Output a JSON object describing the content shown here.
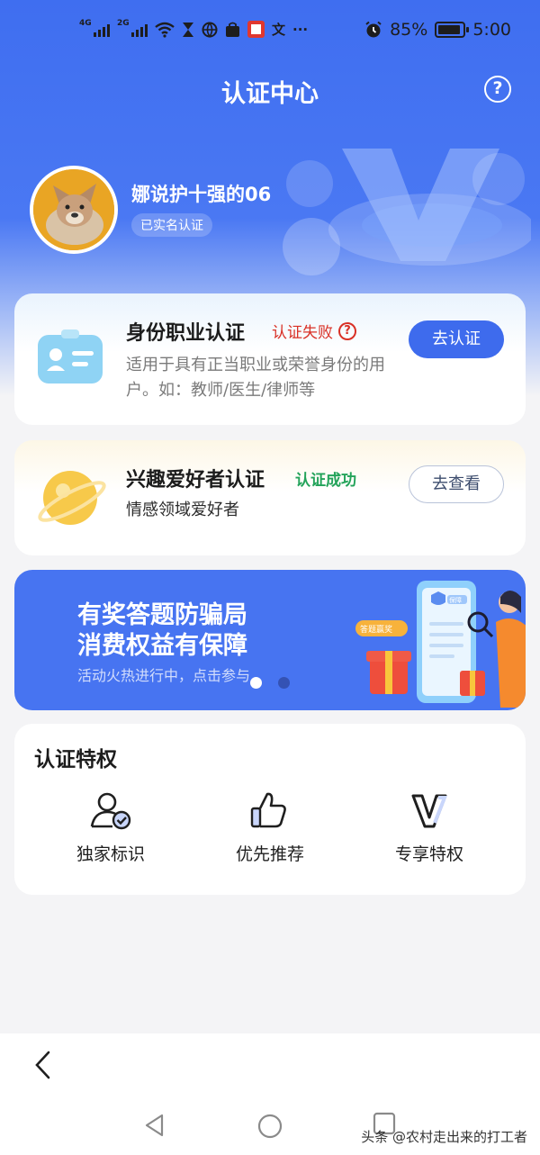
{
  "status_bar": {
    "sim1": "4G",
    "sim2": "2G",
    "text_icon": "文",
    "more": "···",
    "battery_percent": "85%",
    "time": "5:00",
    "icons": [
      "wifi-icon",
      "hourglass-icon",
      "globe-icon",
      "bag-icon",
      "book-icon",
      "alarm-icon",
      "battery-icon"
    ]
  },
  "header": {
    "title": "认证中心",
    "help_icon": "?"
  },
  "profile": {
    "username": "娜说护十强的06",
    "badge": "已实名认证"
  },
  "cards": [
    {
      "title": "身份职业认证",
      "status": "认证失败",
      "status_color": "#d93025",
      "description": "适用于具有正当职业或荣誉身份的用户。如：教师/医生/律师等",
      "button": "去认证"
    },
    {
      "title": "兴趣爱好者认证",
      "status": "认证成功",
      "status_color": "#23a35a",
      "description": "情感领域爱好者",
      "button": "去查看"
    }
  ],
  "banner": {
    "line1": "有奖答题防骗局",
    "line2": "消费权益有保障",
    "subtitle": "活动火热进行中，点击参与",
    "tag": "答题赢奖",
    "shield_label": "保障",
    "active_slide": 1,
    "slide_count": 2
  },
  "privileges": {
    "title": "认证特权",
    "items": [
      {
        "label": "独家标识",
        "icon": "user-badge-icon"
      },
      {
        "label": "优先推荐",
        "icon": "thumbs-up-icon"
      },
      {
        "label": "专享特权",
        "icon": "v-icon"
      }
    ]
  },
  "nav": {
    "back_icon": "back-arrow-icon"
  },
  "watermark": "头条 @农村走出来的打工者",
  "colors": {
    "primary": "#3e6bed",
    "fail": "#d93025",
    "success": "#23a35a"
  }
}
